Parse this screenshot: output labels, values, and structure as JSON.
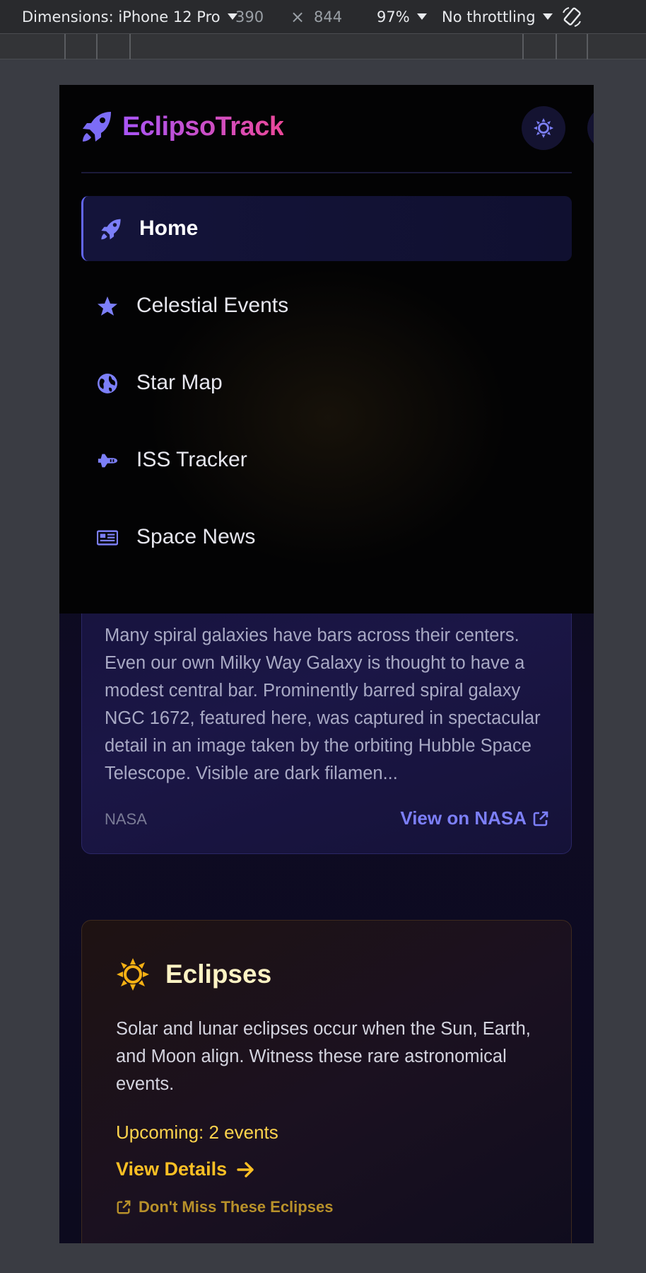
{
  "devtools": {
    "dimensions_label": "Dimensions: iPhone 12 Pro",
    "width_value": "390",
    "times": "×",
    "height_value": "844",
    "zoom": "97%",
    "throttling": "No throttling"
  },
  "app": {
    "brand": "EclipsoTrack",
    "theme_toggle_icon": "sun-icon",
    "close_icon": "close-icon",
    "accent": "#6366f1"
  },
  "nav": {
    "items": [
      {
        "label": "Home",
        "icon": "rocket-icon",
        "active": true
      },
      {
        "label": "Celestial Events",
        "icon": "star-icon",
        "active": false
      },
      {
        "label": "Star Map",
        "icon": "globe-icon",
        "active": false
      },
      {
        "label": "ISS Tracker",
        "icon": "shuttle-icon",
        "active": false
      },
      {
        "label": "Space News",
        "icon": "newspaper-icon",
        "active": false
      }
    ]
  },
  "apod": {
    "description": "Many spiral galaxies have bars across their centers. Even our own Milky Way Galaxy is thought to have a modest central bar. Prominently barred spiral galaxy NGC 1672, featured here, was captured in spectacular detail in an image taken by the orbiting Hubble Space Telescope. Visible are dark filamen...",
    "source": "NASA",
    "link_label": "View on NASA"
  },
  "eclipses": {
    "title": "Eclipses",
    "description": "Solar and lunar eclipses occur when the Sun, Earth, and Moon align. Witness these rare astronomical events.",
    "upcoming": "Upcoming: 2 events",
    "details_label": "View Details",
    "miss_label": "Don't Miss These Eclipses"
  }
}
